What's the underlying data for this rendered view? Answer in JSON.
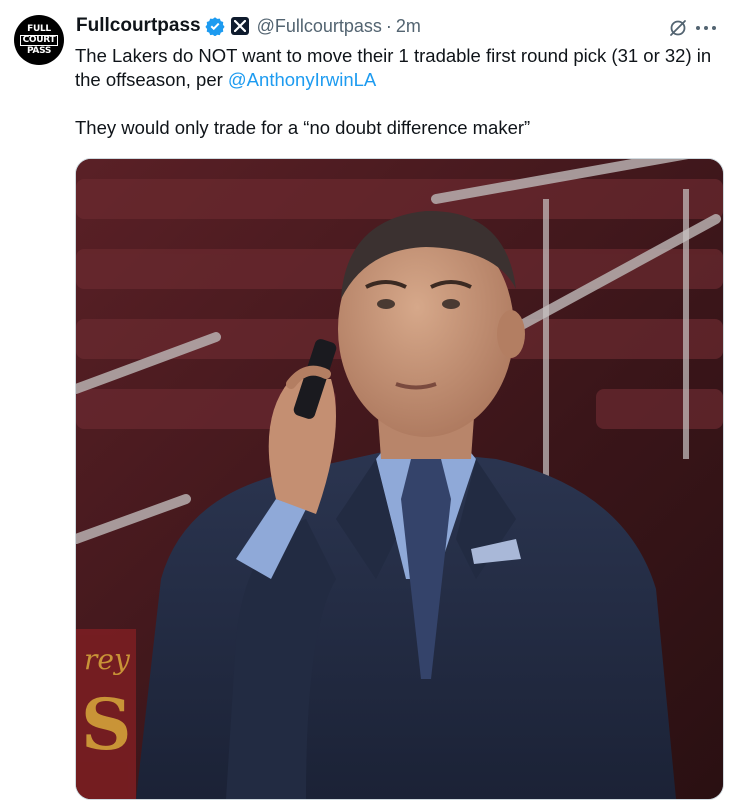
{
  "post": {
    "avatar_text": [
      "FULL",
      "COURT",
      "PASS"
    ],
    "display_name": "Fullcourtpass",
    "handle": "@Fullcourtpass",
    "separator": "·",
    "time": "2m",
    "text_line1": "The Lakers do NOT want to move their 1 tradable first round pick (31 or 32) in the offseason, per ",
    "mention": "@AnthonyIrwinLA",
    "text_line2": "They would only trade for a “no doubt difference maker”"
  },
  "icons": {
    "verified": "verified-badge-icon",
    "affiliate": "x-affiliate-badge-icon",
    "grok": "grok-icon",
    "more": "more-options-icon"
  },
  "colors": {
    "accent": "#1d9bf0",
    "text": "#0f1419",
    "secondary": "#536471"
  },
  "media": {
    "description_icon": "photo"
  }
}
